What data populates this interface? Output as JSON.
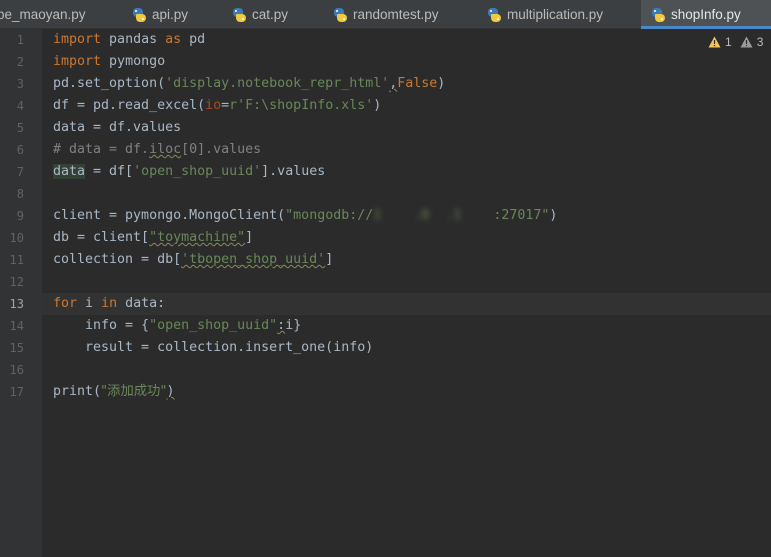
{
  "tabs": [
    {
      "label": "pe_maoyan.py",
      "icon": "python-file-icon",
      "active": false
    },
    {
      "label": "api.py",
      "icon": "python-file-icon",
      "active": false
    },
    {
      "label": "cat.py",
      "icon": "python-file-icon",
      "active": false
    },
    {
      "label": "randomtest.py",
      "icon": "python-file-icon",
      "active": false
    },
    {
      "label": "multiplication.py",
      "icon": "python-file-icon",
      "active": false
    },
    {
      "label": "shopInfo.py",
      "icon": "python-file-icon",
      "active": true
    }
  ],
  "inspections": {
    "warnings_yellow": "1",
    "warnings_gray": "3",
    "yellow_color": "#f2c55c",
    "gray_color": "#9b9b9b"
  },
  "current_line": 13,
  "line_numbers": [
    "1",
    "2",
    "3",
    "4",
    "5",
    "6",
    "7",
    "8",
    "9",
    "10",
    "11",
    "12",
    "13",
    "14",
    "15",
    "16",
    "17"
  ],
  "code": {
    "l1": {
      "kw1": "import",
      "t1": " pandas ",
      "kw2": "as",
      "t2": " pd"
    },
    "l2": {
      "kw1": "import",
      "t1": " pymongo"
    },
    "l3": {
      "t1": "pd.set_option(",
      "s1": "'display.notebook_repr_html'",
      "t2": ",",
      "kw1": "False",
      "t3": ")"
    },
    "l4": {
      "t1": "df = pd.read_excel(",
      "p1": "io",
      "t2": "=",
      "s1": "r'F:\\shopInfo.xls'",
      "t3": ")"
    },
    "l5": {
      "t1": "data = df.values"
    },
    "l6": {
      "c1": "# data = df.",
      "c2": "iloc",
      "c3": "[0].values"
    },
    "l7": {
      "v1": "data",
      "t1": " = df[",
      "s1": "'open_shop_uuid'",
      "t2": "].values"
    },
    "l9": {
      "t1": "client = pymongo.MongoClient(",
      "s1": "\"mongodb://",
      "s_blur": "1    .0  .1    ",
      "s2": ":27017\"",
      "t2": ")"
    },
    "l10": {
      "t1": "db = client[",
      "s1": "\"toymachine\"",
      "t2": "]"
    },
    "l11": {
      "t1": "collection = db[",
      "s1": "'tbopen_shop_uuid'",
      "t2": "]"
    },
    "l13": {
      "kw1": "for",
      "t1": " i ",
      "kw2": "in",
      "t2": " data:"
    },
    "l14": {
      "t1": "    info = {",
      "s1": "\"open_shop_uuid\"",
      "t2": ":",
      "t3": "i}"
    },
    "l15": {
      "t1": "    result = collection.insert_one(info)"
    },
    "l17": {
      "t1": "print(",
      "s1": "\"添加成功\"",
      "t2": ")"
    }
  }
}
